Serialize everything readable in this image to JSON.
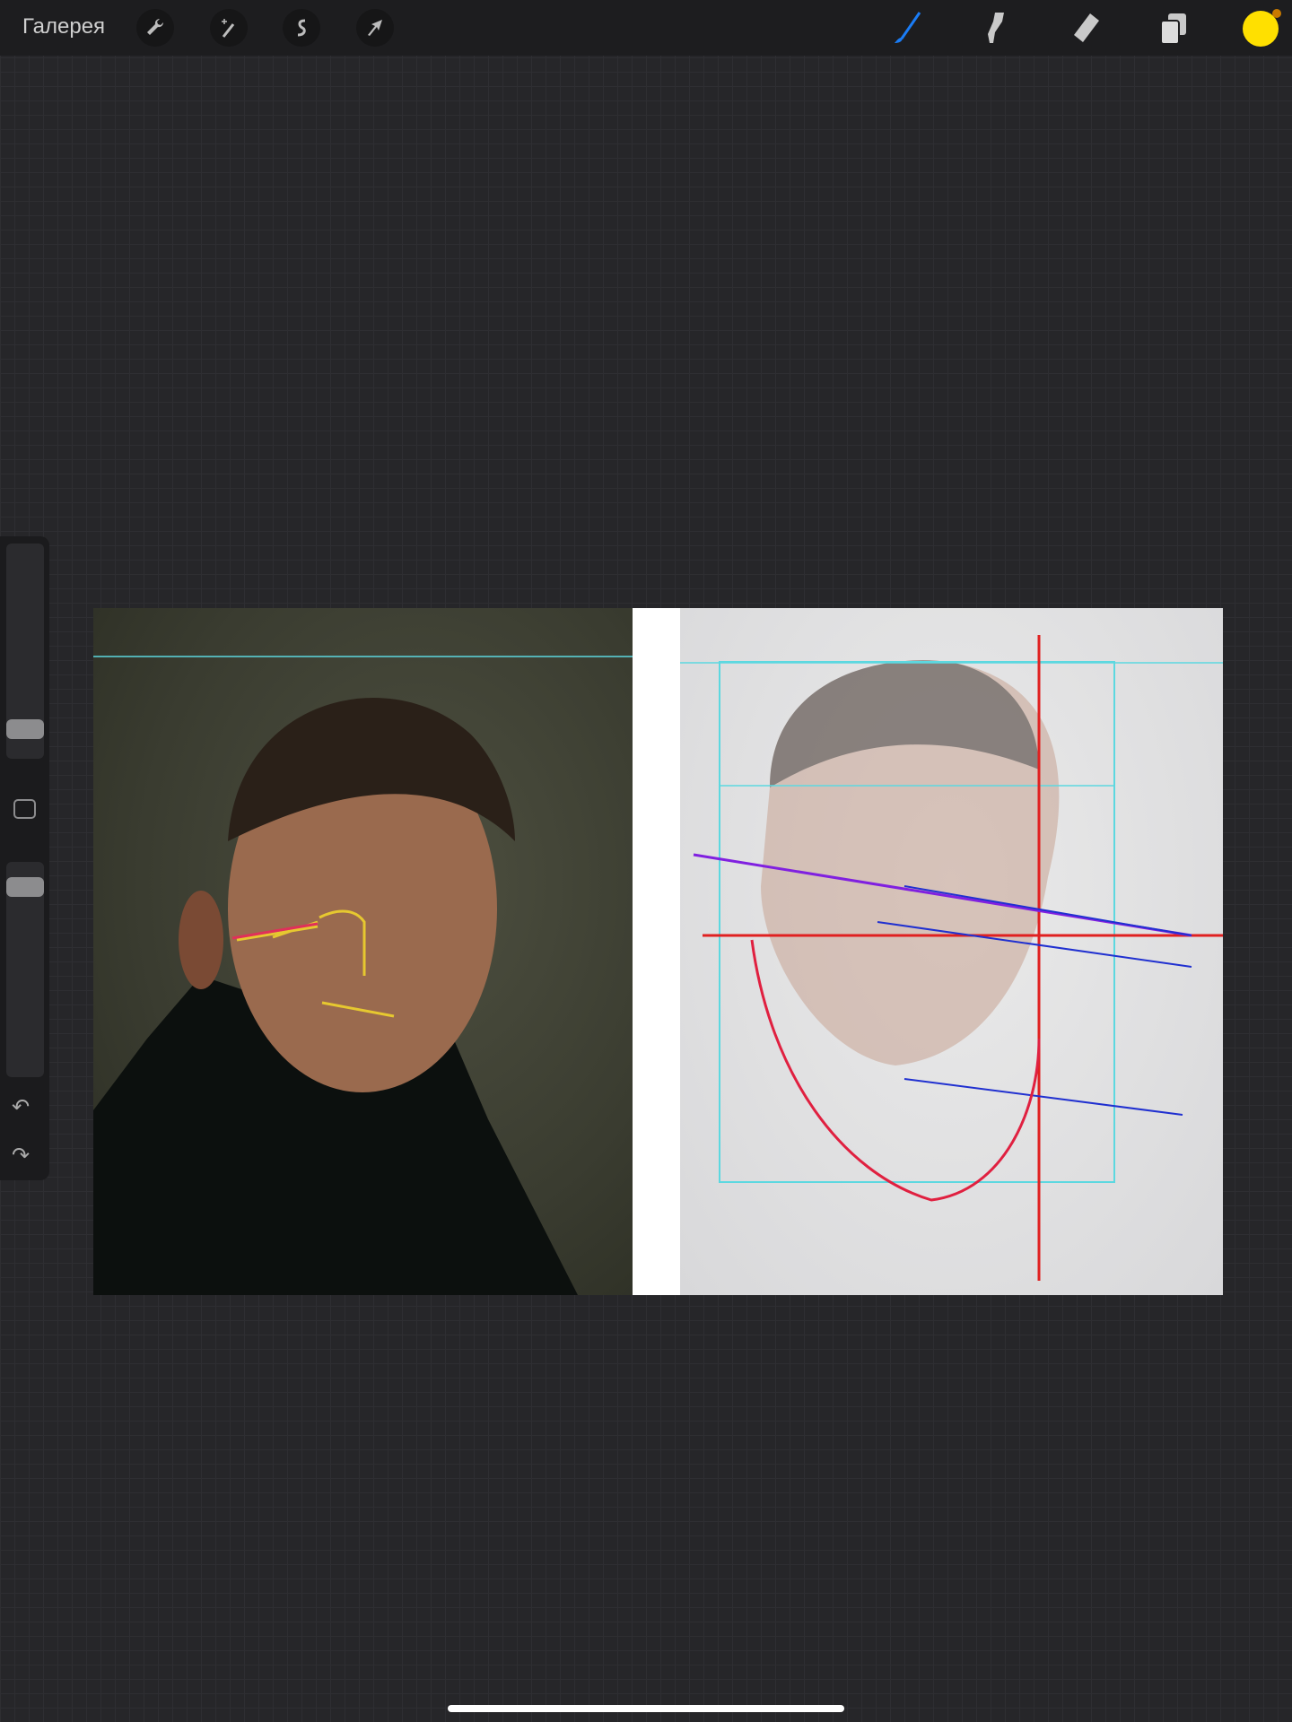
{
  "toolbar": {
    "gallery_label": "Галерея",
    "left_tools": [
      "wrench-icon",
      "magic-wand-icon",
      "selection-icon",
      "move-arrow-icon"
    ],
    "right_tools": [
      "brush-icon",
      "smudge-icon",
      "eraser-icon",
      "layers-icon"
    ],
    "active_tool": "brush",
    "current_color": "#ffe000",
    "accent": "#1a7cf5"
  },
  "sidebar": {
    "brush_size": 0.1,
    "opacity": 0.92,
    "undo": "undo-icon",
    "redo": "redo-icon"
  }
}
